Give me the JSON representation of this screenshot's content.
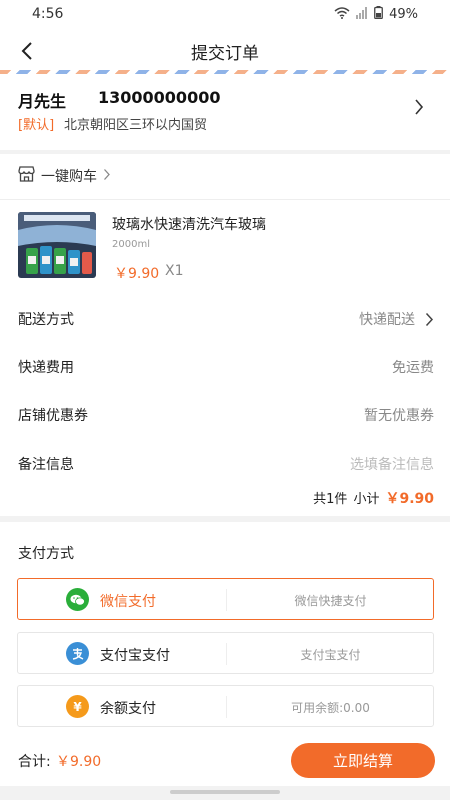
{
  "status_bar": {
    "time": "4:56",
    "battery": "49%"
  },
  "nav": {
    "title": "提交订单"
  },
  "address": {
    "name": "月先生",
    "phone": "13000000000",
    "tag": "[默认]",
    "detail": "北京朝阳区三环以内国贸"
  },
  "shop": {
    "label": "一键购车"
  },
  "product": {
    "name": "玻璃水快速清洗汽车玻璃",
    "spec": "2000ml",
    "price": "￥9.90",
    "qty": "X1"
  },
  "order_rows": [
    {
      "label": "配送方式",
      "value": "快递配送"
    },
    {
      "label": "快递费用",
      "value": "免运费"
    },
    {
      "label": "店铺优惠券",
      "value": "暂无优惠券"
    },
    {
      "label": "备注信息",
      "placeholder": "选填备注信息"
    }
  ],
  "subtotal": {
    "count": "共1件",
    "label": "小计",
    "price": "￥9.90"
  },
  "payment": {
    "title": "支付方式",
    "options": [
      {
        "label": "微信支付",
        "desc": "微信快捷支付",
        "icon": "wechat-icon",
        "color": "#2aae3a",
        "selected": true
      },
      {
        "label": "支付宝支付",
        "desc": "支付宝支付",
        "icon": "alipay-icon",
        "color": "#3a8fd6",
        "selected": false
      },
      {
        "label": "余额支付",
        "desc": "可用余额:0.00",
        "icon": "yen-icon",
        "color": "#f59a1b",
        "selected": false
      }
    ]
  },
  "bottom": {
    "total_label": "合计:",
    "total_price": "￥9.90",
    "checkout_label": "立即结算"
  },
  "colors": {
    "accent": "#f26b2a"
  }
}
